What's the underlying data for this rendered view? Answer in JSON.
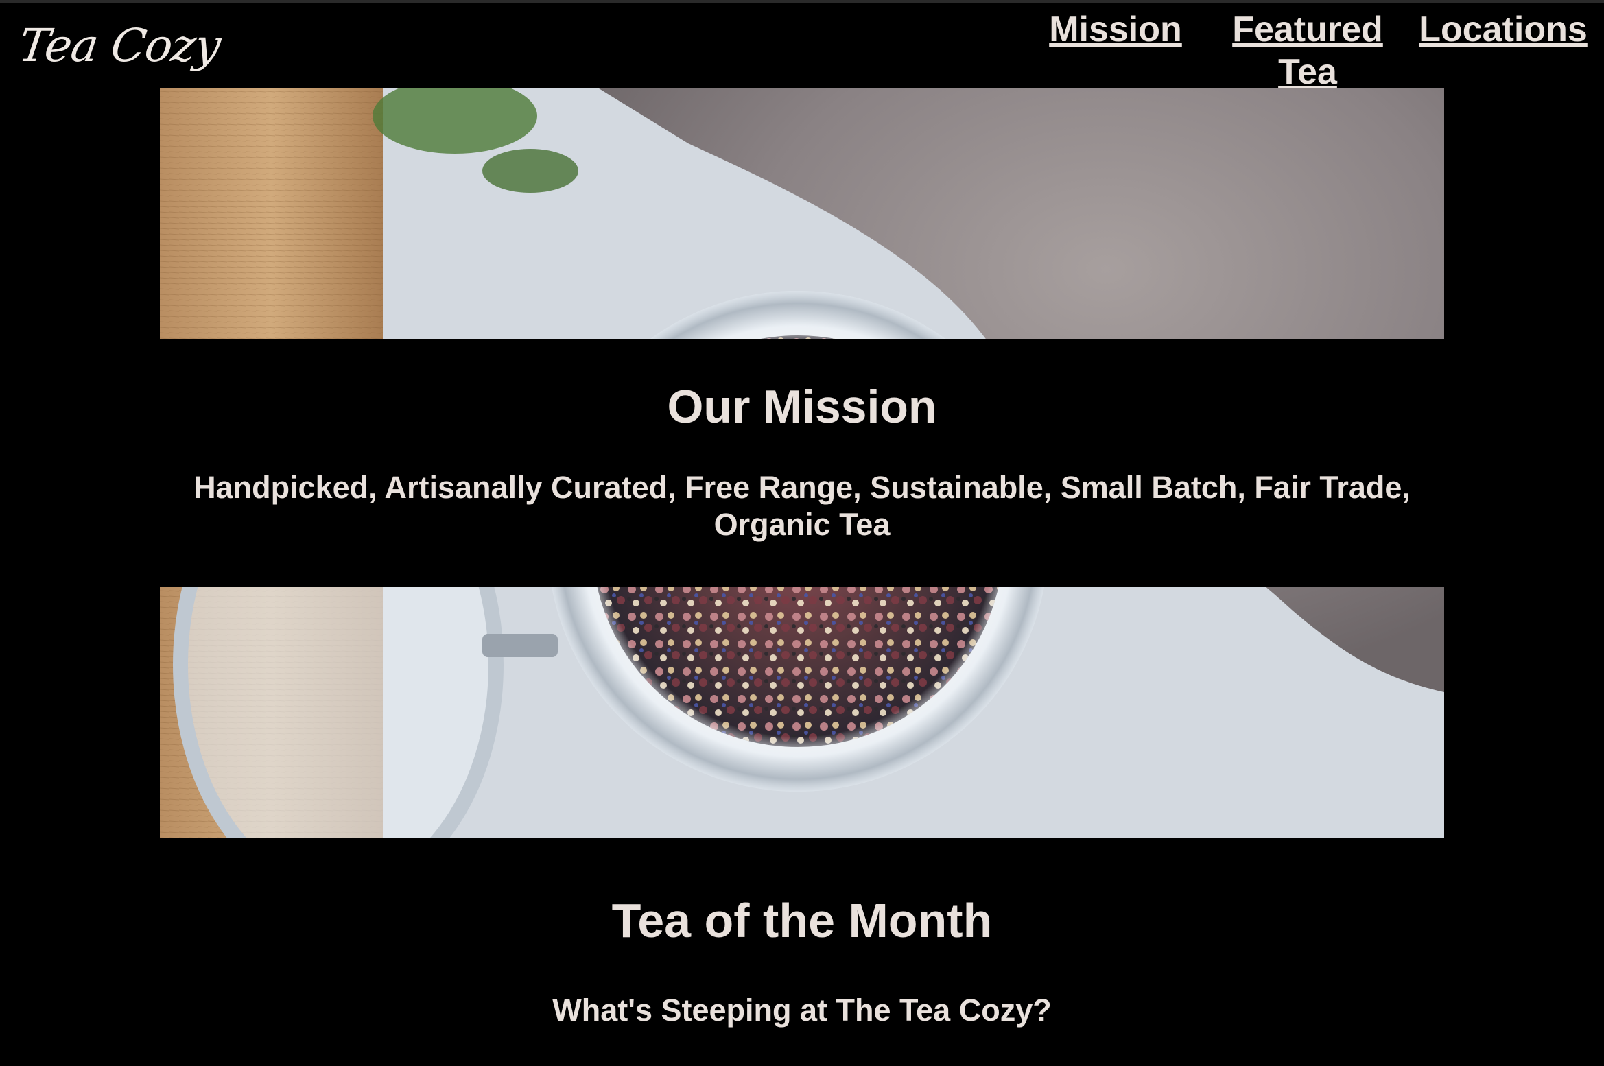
{
  "header": {
    "logo_text": "Tea Cozy",
    "nav": {
      "mission": "Mission",
      "featured_tea": "Featured Tea",
      "locations": "Locations"
    }
  },
  "hero": {
    "image": "tea-jar-photo",
    "title": "Our Mission",
    "text": "Handpicked, Artisanally Curated, Free Range, Sustainable, Small Batch, Fair Trade, Organic Tea"
  },
  "tea_of_month": {
    "title": "Tea of the Month",
    "subtitle": "What's Steeping at The Tea Cozy?"
  },
  "colors": {
    "background": "#000000",
    "text": "#e9e1dc",
    "divider": "#9a9590"
  }
}
